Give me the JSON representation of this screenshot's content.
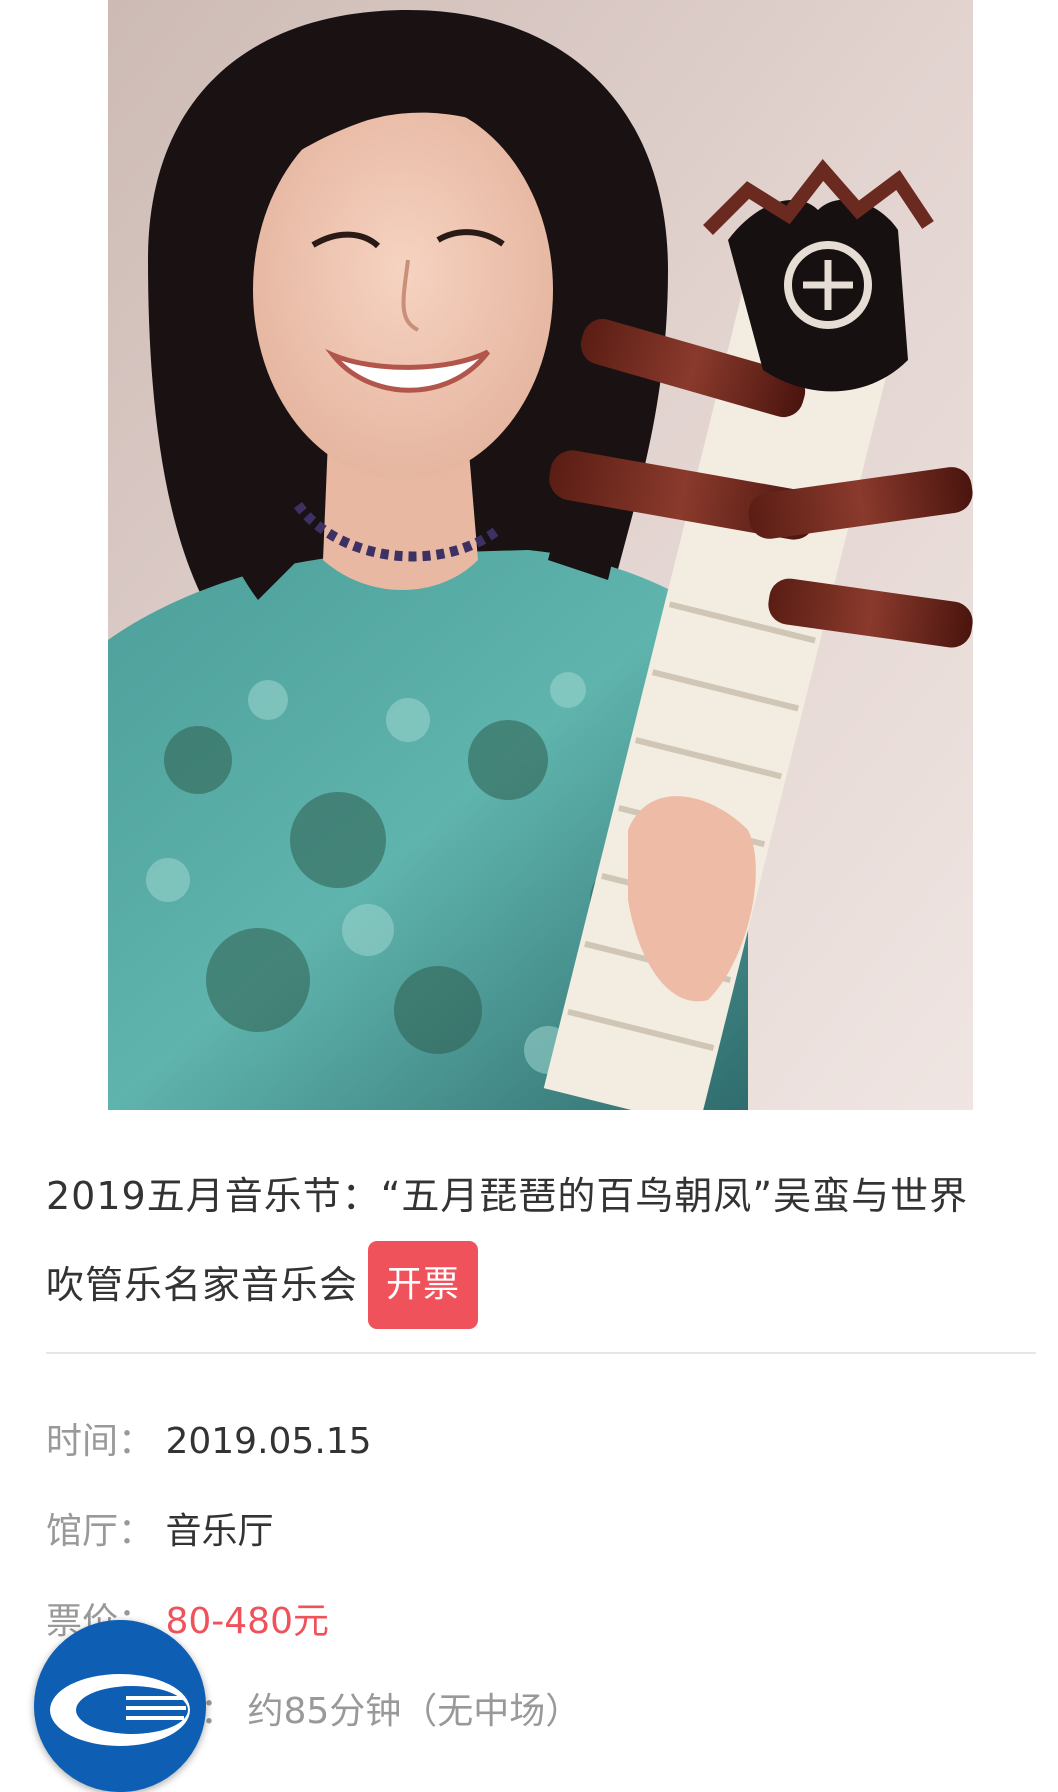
{
  "event": {
    "title_line1": "2019五月音乐节：“五月琵琶的百鸟朝凤”吴蛮与世界",
    "title_line2": "吹管乐名家音乐会",
    "status_badge": "开票"
  },
  "info": {
    "time_label": "时间：",
    "time_value": "2019.05.15",
    "hall_label": "馆厅：",
    "hall_value": "音乐厅",
    "price_label": "票价：",
    "price_value": "80-480元",
    "duration_label": "：",
    "duration_value": "约85分钟（无中场）"
  },
  "photo": {
    "subject": "performer-with-pipa-photo"
  },
  "logo": {
    "icon": "venue-logo-icon"
  },
  "colors": {
    "accent": "#f0525b",
    "label": "#999999",
    "text": "#333333",
    "logo_blue": "#0e5fb3"
  }
}
